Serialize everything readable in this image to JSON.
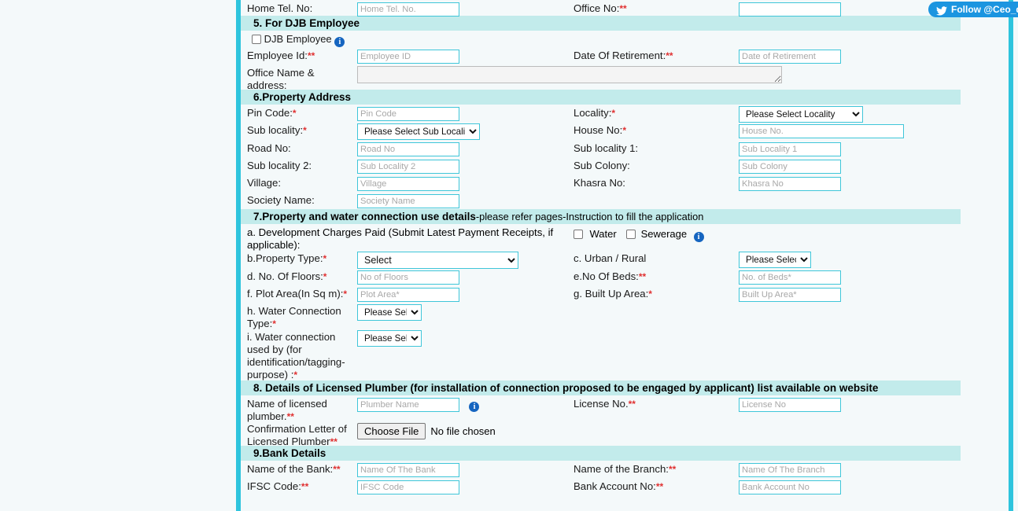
{
  "colors": {
    "rail": "#2ec4dd",
    "section_header_bg": "#c2ebeb",
    "input_border": "#3fc6d9",
    "required_mark": "#e03131",
    "page_bg": "#f4f9fa",
    "twitter_blue": "#1b95e0"
  },
  "top_row": {
    "home_tel_label": "Home Tel. No:",
    "home_tel_placeholder": "Home Tel. No.",
    "office_no_label": "Office No:",
    "office_no_required": "**"
  },
  "twitter": {
    "label": "Follow @Ceo_djb",
    "icon": "twitter-bird-icon"
  },
  "section5": {
    "title": "5. For DJB Employee",
    "djb_employee_checkbox_label": "DJB Employee",
    "djb_employee_checked": false,
    "employee_id_label": "Employee Id:",
    "employee_id_required": "**",
    "employee_id_placeholder": "Employee ID",
    "date_of_retirement_label": "Date Of Retirement:",
    "date_of_retirement_required": "**",
    "date_of_retirement_placeholder": "Date of Retirement",
    "office_name_label_line1": "Office Name &",
    "office_name_label_line2": "address:",
    "office_name_value": ""
  },
  "section6": {
    "title": "6.Property Address",
    "pin_code_label": "Pin Code:",
    "pin_code_required": "*",
    "pin_code_placeholder": "Pin Code",
    "locality_label": "Locality:",
    "locality_required": "*",
    "locality_selected": "Please Select Locality",
    "sub_locality_label": "Sub locality:",
    "sub_locality_required": "*",
    "sub_locality_selected": "Please Select Sub Locality",
    "house_no_label": "House No:",
    "house_no_required": "*",
    "house_no_placeholder": "House No.",
    "road_no_label": "Road No:",
    "road_no_placeholder": "Road No",
    "sub_locality1_label": "Sub locality 1:",
    "sub_locality1_placeholder": "Sub Locality 1",
    "sub_locality2_label": "Sub locality 2:",
    "sub_locality2_placeholder": "Sub Locality 2",
    "sub_colony_label": "Sub Colony:",
    "sub_colony_placeholder": "Sub Colony",
    "village_label": "Village:",
    "village_placeholder": "Village",
    "khasra_no_label": "Khasra No:",
    "khasra_no_placeholder": "Khasra No",
    "society_name_label": "Society Name:",
    "society_name_placeholder": "Society Name"
  },
  "section7": {
    "title_bold": "7.Property and water connection use details",
    "title_normal": "-please refer pages-Instruction to fill the application",
    "dev_charges_label_line1": "a. Development Charges Paid (Submit Latest Payment Receipts, if",
    "dev_charges_label_line2": "applicable):",
    "water_checkbox_label": "Water",
    "water_checked": false,
    "sewerage_checkbox_label": "Sewerage",
    "sewerage_checked": false,
    "property_type_label": "b.Property Type:",
    "property_type_required": "*",
    "property_type_selected": "Select",
    "urban_rural_label": "c. Urban / Rural",
    "urban_rural_selected": "Please Select",
    "no_of_floors_label": "d. No. Of Floors:",
    "no_of_floors_required": "*",
    "no_of_floors_placeholder": "No of Floors",
    "no_of_beds_label": "e.No Of Beds:",
    "no_of_beds_required": "**",
    "no_of_beds_placeholder": "No. of Beds*",
    "plot_area_label": "f. Plot Area(In Sq m):",
    "plot_area_required": "*",
    "plot_area_placeholder": "Plot Area*",
    "built_up_area_label": "g. Built Up Area:",
    "built_up_area_required": "*",
    "built_up_area_placeholder": "Built Up Area*",
    "water_conn_type_label_line1": "h. Water Connection",
    "water_conn_type_label_line2": "Type:",
    "water_conn_type_required": "*",
    "water_conn_type_selected": "Please Select",
    "water_used_by_label_line1": "i. Water connection",
    "water_used_by_label_line2": "used by (for",
    "water_used_by_label_line3": "identification/tagging-",
    "water_used_by_label_line4": "purpose) :",
    "water_used_by_required": "*",
    "water_used_by_selected": "Please Select"
  },
  "section8": {
    "title": "8. Details of Licensed Plumber (for installation of connection proposed to be engaged by applicant) list available on website",
    "plumber_name_label_line1": "Name of licensed",
    "plumber_name_label_line2": "plumber.",
    "plumber_name_required": "**",
    "plumber_name_placeholder": "Plumber Name",
    "license_no_label": "License No.",
    "license_no_required": "**",
    "license_no_placeholder": "License No",
    "confirmation_letter_label_line1": "Confirmation Letter of",
    "confirmation_letter_label_line2": "Licensed Plumber",
    "confirmation_letter_required": "**",
    "choose_file_button": "Choose File",
    "no_file_chosen": "No file chosen"
  },
  "section9": {
    "title": "9.Bank Details",
    "bank_name_label": "Name of the Bank:",
    "bank_name_required": "**",
    "bank_name_placeholder": "Name Of The Bank",
    "branch_name_label": "Name of the Branch:",
    "branch_name_required": "**",
    "branch_name_placeholder": "Name Of The Branch",
    "ifsc_label": "IFSC Code:",
    "ifsc_required": "**",
    "ifsc_placeholder": "IFSC Code",
    "bank_account_label": "Bank Account No:",
    "bank_account_required": "**",
    "bank_account_placeholder": "Bank Account No"
  }
}
